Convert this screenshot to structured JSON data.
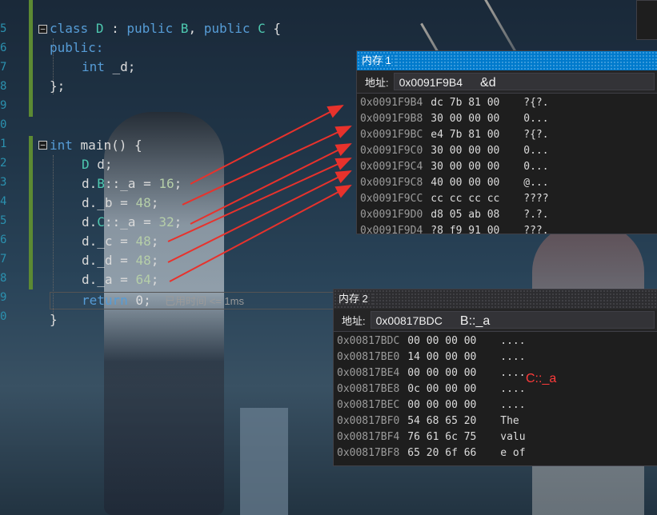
{
  "editor": {
    "line_numbers": [
      "5",
      "6",
      "7",
      "8",
      "9",
      "0",
      "1",
      "2",
      "3",
      "4",
      "5",
      "6",
      "7",
      "8",
      "9",
      "0"
    ],
    "class_decl": {
      "kw": "class",
      "name": "D",
      "sep": " : ",
      "pub1": "public",
      "base1": "B",
      "comma": ", ",
      "pub2": "public",
      "base2": "C",
      "brace": " {"
    },
    "access": "public:",
    "member": {
      "type": "int",
      "name": " _d;"
    },
    "class_close": "};",
    "main_decl": {
      "type": "int",
      "rest": " main() {"
    },
    "stmt_decl": {
      "type": "D",
      "rest": " d;"
    },
    "stmts": [
      {
        "pre": "d.",
        "scope": "B",
        "mid": "::_a = ",
        "num": "16",
        "end": ";"
      },
      {
        "pre": "d._b = ",
        "scope": "",
        "mid": "",
        "num": "48",
        "end": ";"
      },
      {
        "pre": "d.",
        "scope": "C",
        "mid": "::_a = ",
        "num": "32",
        "end": ";"
      },
      {
        "pre": "d._c = ",
        "scope": "",
        "mid": "",
        "num": "48",
        "end": ";"
      },
      {
        "pre": "d._d = ",
        "scope": "",
        "mid": "",
        "num": "48",
        "end": ";"
      },
      {
        "pre": "d._a = ",
        "scope": "",
        "mid": "",
        "num": "64",
        "end": ";"
      }
    ],
    "return_stmt": {
      "kw": "return",
      "rest": " 0;"
    },
    "elapsed_hint": "已用时间 <= 1ms",
    "main_close": "}"
  },
  "memory1": {
    "title": "内存 1",
    "address_label": "地址:",
    "address_value": "0x0091F9B4",
    "annotation": "&d",
    "rows": [
      {
        "addr": "0x0091F9B4",
        "bytes": "dc 7b 81 00",
        "ascii": "?{?."
      },
      {
        "addr": "0x0091F9B8",
        "bytes": "30 00 00 00",
        "ascii": "0..."
      },
      {
        "addr": "0x0091F9BC",
        "bytes": "e4 7b 81 00",
        "ascii": "?{?."
      },
      {
        "addr": "0x0091F9C0",
        "bytes": "30 00 00 00",
        "ascii": "0..."
      },
      {
        "addr": "0x0091F9C4",
        "bytes": "30 00 00 00",
        "ascii": "0..."
      },
      {
        "addr": "0x0091F9C8",
        "bytes": "40 00 00 00",
        "ascii": "@..."
      },
      {
        "addr": "0x0091F9CC",
        "bytes": "cc cc cc cc",
        "ascii": "????"
      },
      {
        "addr": "0x0091F9D0",
        "bytes": "d8 05 ab 08",
        "ascii": "?.?."
      },
      {
        "addr": "0x0091F9D4",
        "bytes": "?8 f9 91 00",
        "ascii": "???."
      }
    ]
  },
  "memory2": {
    "title": "内存 2",
    "address_label": "地址:",
    "address_value": "0x00817BDC",
    "annotation": "B::_a",
    "side_annotation": "C::_a",
    "rows": [
      {
        "addr": "0x00817BDC",
        "bytes": "00 00 00 00",
        "ascii": "...."
      },
      {
        "addr": "0x00817BE0",
        "bytes": "14 00 00 00",
        "ascii": "...."
      },
      {
        "addr": "0x00817BE4",
        "bytes": "00 00 00 00",
        "ascii": "...."
      },
      {
        "addr": "0x00817BE8",
        "bytes": "0c 00 00 00",
        "ascii": "...."
      },
      {
        "addr": "0x00817BEC",
        "bytes": "00 00 00 00",
        "ascii": "...."
      },
      {
        "addr": "0x00817BF0",
        "bytes": "54 68 65 20",
        "ascii": "The "
      },
      {
        "addr": "0x00817BF4",
        "bytes": "76 61 6c 75",
        "ascii": "valu"
      },
      {
        "addr": "0x00817BF8",
        "bytes": "65 20 6f 66",
        "ascii": "e of"
      }
    ]
  },
  "colors": {
    "arrow": "#e8322c",
    "annotation": "#ff3b3b",
    "accent": "#007acc"
  }
}
